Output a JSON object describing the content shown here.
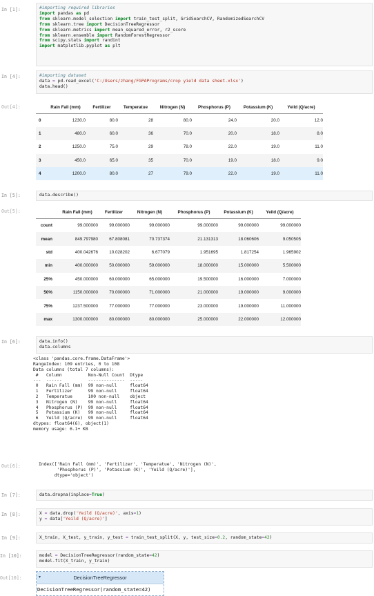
{
  "cells": {
    "c1": {
      "prompt": "In [1]:",
      "comment": "#importing required libraries",
      "lines": [
        [
          "import",
          " pandas ",
          "as",
          " pd"
        ],
        [
          "from",
          " sklearn.model_selection ",
          "import",
          " train_test_split, GridSearchCV, RandomizedSearchCV"
        ],
        [
          "from",
          " sklearn.tree ",
          "import",
          " DecisionTreeRegressor"
        ],
        [
          "from",
          " sklearn.metrics ",
          "import",
          " mean_squared_error, r2_score"
        ],
        [
          "from",
          " sklearn.ensemble ",
          "import",
          " RandomForestRegressor"
        ],
        [
          "from",
          " scipy.stats ",
          "import",
          " randint"
        ],
        [
          "import",
          " matplotlib.pyplot ",
          "as",
          " plt"
        ]
      ]
    },
    "c4": {
      "prompt": "In [4]:",
      "comment": "#importing dataset",
      "line1_a": "data ",
      "line1_op": "=",
      "line1_b": " pd.read_excel(",
      "line1_str": "'C:/Users/zhang/FGPAPrograms/crop yield data sheet.xlsx'",
      "line1_c": ")",
      "line2": "data.head()",
      "out_prompt": "Out[4]:"
    },
    "head_table": {
      "columns": [
        "",
        "Rain Fall (mm)",
        "Fertilizer",
        "Temperatue",
        "Nitrogen (N)",
        "Phosphorus (P)",
        "Potassium (K)",
        "Yeild (Q/acre)"
      ],
      "rows": [
        [
          "0",
          "1230.0",
          "80.0",
          "28",
          "80.0",
          "24.0",
          "20.0",
          "12.0"
        ],
        [
          "1",
          "480.0",
          "60.0",
          "36",
          "70.0",
          "20.0",
          "18.0",
          "8.0"
        ],
        [
          "2",
          "1250.0",
          "75.0",
          "29",
          "78.0",
          "22.0",
          "19.0",
          "11.0"
        ],
        [
          "3",
          "450.0",
          "65.0",
          "35",
          "70.0",
          "19.0",
          "18.0",
          "9.0"
        ],
        [
          "4",
          "1200.0",
          "80.0",
          "27",
          "79.0",
          "22.0",
          "19.0",
          "11.0"
        ]
      ]
    },
    "c5": {
      "prompt": "In [5]:",
      "code": "data.describe()",
      "out_prompt": "Out[5]:"
    },
    "describe_table": {
      "columns": [
        "",
        "Rain Fall (mm)",
        "Fertilizer",
        "Nitrogen (N)",
        "Phosphorus (P)",
        "Potassium (K)",
        "Yeild (Q/acre)"
      ],
      "rows": [
        [
          "count",
          "99.000000",
          "99.000000",
          "99.000000",
          "99.000000",
          "99.000000",
          "99.000000"
        ],
        [
          "mean",
          "849.797980",
          "67.808081",
          "70.737374",
          "21.131313",
          "18.060606",
          "9.050505"
        ],
        [
          "std",
          "400.042676",
          "10.028202",
          "6.677079",
          "1.951695",
          "1.817254",
          "1.965902"
        ],
        [
          "min",
          "400.000000",
          "50.000000",
          "59.000000",
          "18.000000",
          "15.000000",
          "5.500000"
        ],
        [
          "25%",
          "450.000000",
          "60.000000",
          "65.000000",
          "19.500000",
          "16.000000",
          "7.000000"
        ],
        [
          "50%",
          "1150.000000",
          "70.000000",
          "71.000000",
          "21.000000",
          "19.000000",
          "9.000000"
        ],
        [
          "75%",
          "1237.500000",
          "77.000000",
          "77.000000",
          "23.000000",
          "19.000000",
          "11.000000"
        ],
        [
          "max",
          "1300.000000",
          "80.000000",
          "80.000000",
          "25.000000",
          "22.000000",
          "12.000000"
        ]
      ]
    },
    "c6": {
      "prompt": "In [6]:",
      "line1": "data.info()",
      "line2": "data.columns",
      "info_output": "<class 'pandas.core.frame.DataFrame'>\nRangeIndex: 109 entries, 0 to 108\nData columns (total 7 columns):\n #   Column          Non-Null Count  Dtype  \n---  ------          --------------  -----  \n 0   Rain Fall (mm)  99 non-null     float64\n 1   Fertilizer      99 non-null     float64\n 2   Temperatue      100 non-null    object \n 3   Nitrogen (N)    99 non-null     float64\n 4   Phosphorus (P)  99 non-null     float64\n 5   Potassium (K)   99 non-null     float64\n 6   Yeild (Q/acre)  99 non-null     float64\ndtypes: float64(6), object(1)\nmemory usage: 6.1+ KB",
      "out_prompt": "Out[6]:",
      "columns_output": "Index(['Rain Fall (mm)', 'Fertilizer', 'Temperatue', 'Nitrogen (N)',\n       'Phosphorus (P)', 'Potassium (K)', 'Yeild (Q/acre)'],\n      dtype='object')"
    },
    "c7": {
      "prompt": "In [7]:",
      "a": "data.dropna(inplace",
      "op": "=",
      "kw": "True",
      "b": ")"
    },
    "c8": {
      "prompt": "In [8]:",
      "l1_a": "X ",
      "l1_op": "=",
      "l1_b": " data.drop(",
      "l1_str": "'Yeild (Q/acre)'",
      "l1_c": ", axis",
      "l1_op2": "=",
      "l1_num": "1",
      "l1_d": ")",
      "l2_a": "y ",
      "l2_op": "=",
      "l2_b": " data[",
      "l2_str": "'Yeild (Q/acre)'",
      "l2_c": "]"
    },
    "c9": {
      "prompt": "In [9]:",
      "a": "X_train, X_test, y_train, y_test ",
      "op": "=",
      "b": " train_test_split(X, y, test_size",
      "op2": "=",
      "num1": "0.2",
      "c": ", random_state",
      "op3": "=",
      "num2": "42",
      "d": ")"
    },
    "c10": {
      "prompt": "In [10]:",
      "l1_a": "model ",
      "l1_op": "=",
      "l1_b": " DecisionTreeRegressor(random_state",
      "l1_op2": "=",
      "l1_num": "42",
      "l1_c": ")",
      "l2": "model.fit(X_train, y_train)",
      "out_prompt": "Out[10]:",
      "estimator_title": "DecisionTreeRegressor",
      "estimator_icon": "▾",
      "estimator_repr": "DecisionTreeRegressor(random_state=42)"
    }
  }
}
